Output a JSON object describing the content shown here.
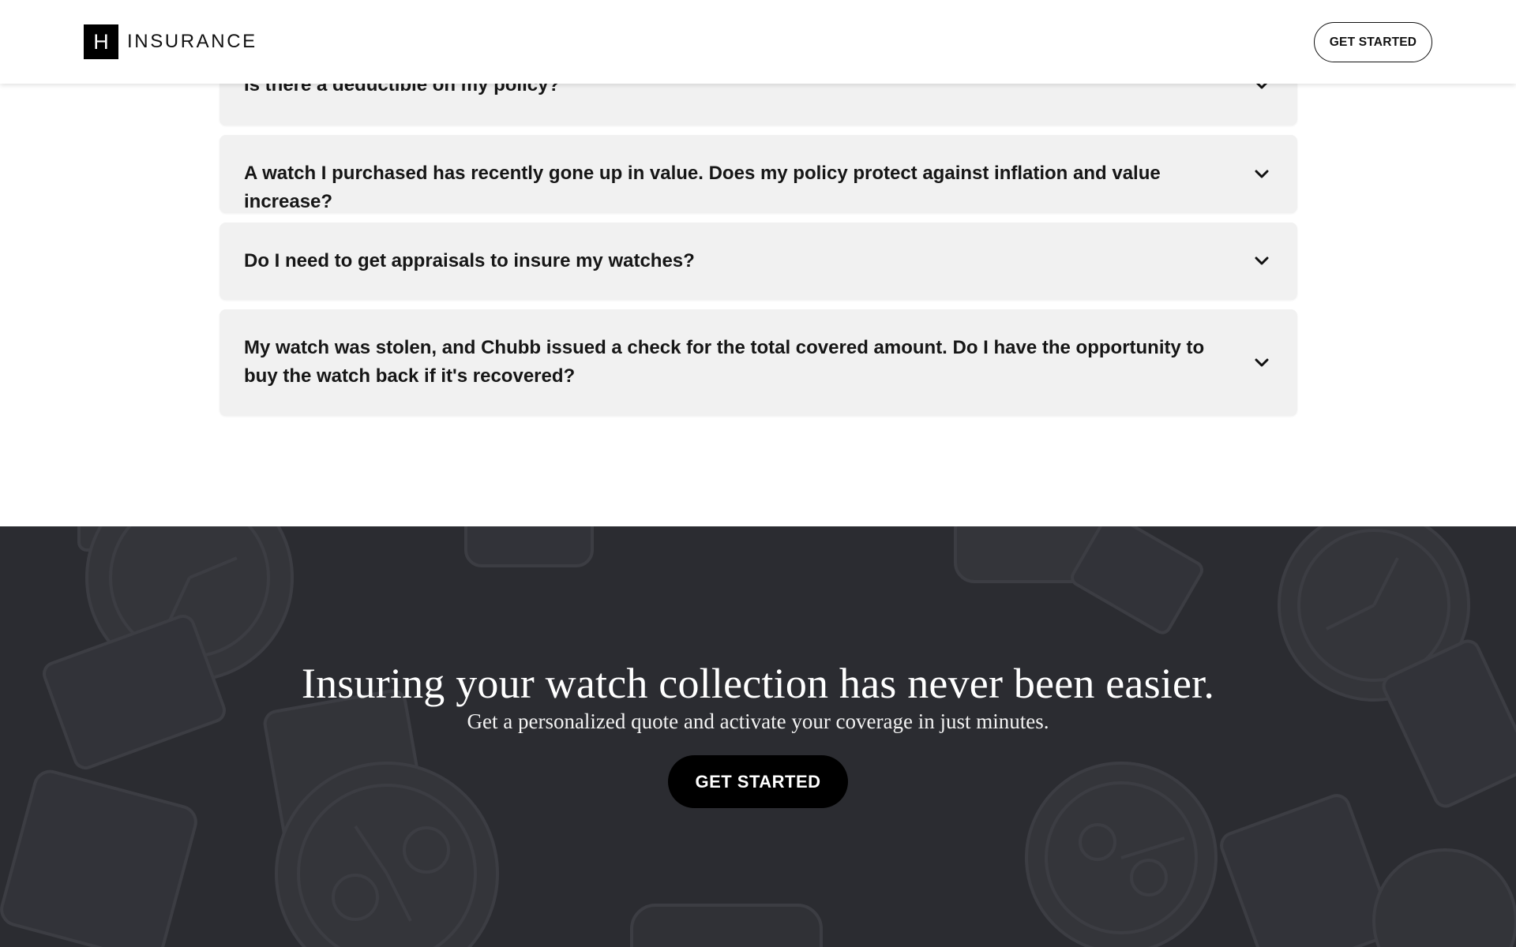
{
  "header": {
    "logo_mark": "H",
    "logo_text": "INSURANCE",
    "cta_label": "GET STARTED"
  },
  "faq": {
    "items": [
      {
        "question": "Is there a deductible on my policy?"
      },
      {
        "question": "A watch I purchased has recently gone up in value. Does my policy protect against inflation and value increase?"
      },
      {
        "question": "Do I need to get appraisals to insure my watches?"
      },
      {
        "question": "My watch was stolen, and Chubb issued a check for the total covered amount. Do I have the opportunity to buy the watch back if it's recovered?"
      }
    ],
    "icon": "chevron-down-icon"
  },
  "cta": {
    "title": "Insuring your watch collection has never been easier.",
    "subtitle": "Get a personalized quote and activate your coverage in just minutes.",
    "button_label": "GET STARTED",
    "background_color": "#2b2c31",
    "background_art": "watch-illustrations"
  },
  "colors": {
    "faq_background": "#f1f1f1",
    "button_dark": "#000000",
    "header_background": "#ffffff"
  }
}
